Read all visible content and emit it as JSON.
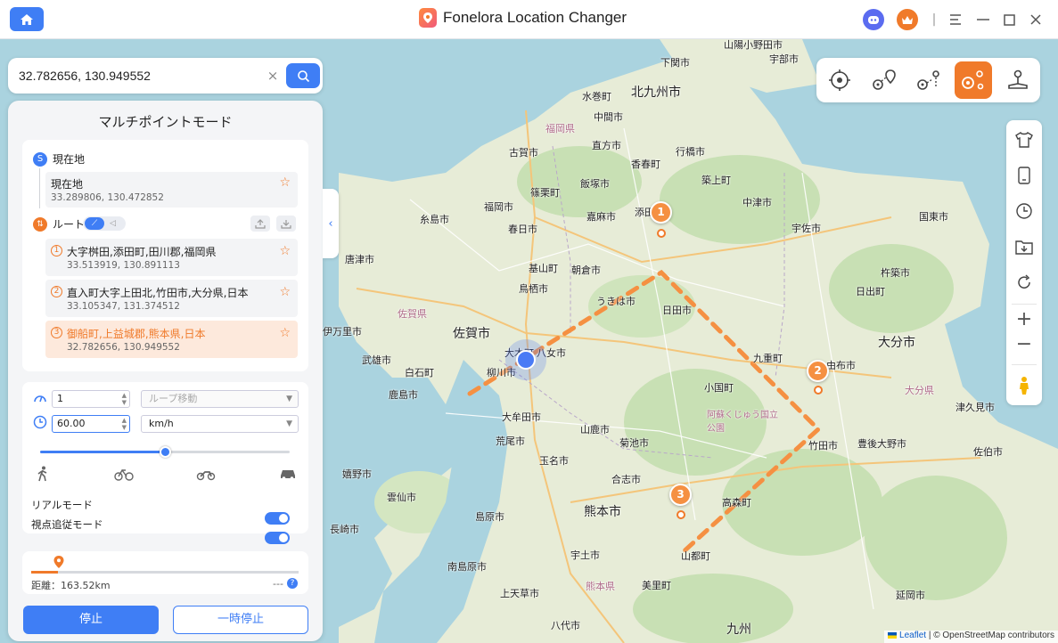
{
  "window": {
    "title": "Fonelora Location Changer"
  },
  "search": {
    "value": "32.782656, 130.949552",
    "clear_icon": "×"
  },
  "panel": {
    "title": "マルチポイントモード",
    "current": {
      "section_label": "現在地",
      "badge": "S",
      "item_name": "現在地",
      "item_coord": "33.289806, 130.472852"
    },
    "route": {
      "section_label": "ルート",
      "items": [
        {
          "num": "1",
          "name": "大字桝田,添田町,田川郡,福岡県",
          "coord": "33.513919, 130.891113"
        },
        {
          "num": "2",
          "name": "直入町大字上田北,竹田市,大分県,日本",
          "coord": "33.105347, 131.374512"
        },
        {
          "num": "3",
          "name": "御船町,上益城郡,熊本県,日本",
          "coord": "32.782656, 130.949552"
        }
      ]
    },
    "controls": {
      "loop_count": "1",
      "loop_mode": "ループ移動",
      "speed": "60.00",
      "speed_unit": "km/h",
      "speed_slider_fraction": 0.5,
      "real_mode_label": "リアルモード",
      "view_follow_label": "視点追従モード"
    },
    "progress": {
      "distance": "距離：163.52km",
      "time": "---",
      "help": "?",
      "progress_fraction": 0.1
    },
    "stop_label": "停止",
    "pause_label": "一時停止"
  },
  "attribution": {
    "leaflet": "Leaflet",
    "rest": "| © OpenStreetMap contributors"
  },
  "map_labels": [
    "山陽小野田市",
    "宇部市",
    "下関市",
    "北九州市",
    "水巻町",
    "中間市",
    "福岡県",
    "直方市",
    "古賀市",
    "香春町",
    "行橋市",
    "築上町",
    "篠栗町",
    "飯塚市",
    "添田",
    "中津市",
    "福岡市",
    "糸島市",
    "春日市",
    "嘉麻市",
    "宇佐市",
    "国東市",
    "基山町",
    "朝倉市",
    "唐津市",
    "鳥栖市",
    "杵築市",
    "日出町",
    "佐賀県",
    "うきは市",
    "日田市",
    "佐賀市",
    "大木町",
    "八女市",
    "九重町",
    "由布市",
    "大分市",
    "武雄市",
    "白石町",
    "柳川市",
    "小国町",
    "大分県",
    "伊万里市",
    "鹿島市",
    "大牟田市",
    "阿蘇くじゅう国立公園",
    "竹田市",
    "豊後大野市",
    "津久見市",
    "荒尾市",
    "山鹿市",
    "菊池市",
    "佐伯市",
    "嬉野市",
    "玉名市",
    "合志市",
    "高森町",
    "南島原市",
    "熊本市",
    "島原市",
    "宇土市",
    "山都町",
    "上天草市",
    "美里町",
    "延岡市",
    "八代市",
    "九州",
    "熊本県",
    "雲仙市",
    "長崎市"
  ],
  "colors": {
    "accent": "#3f7ef5",
    "route": "#f07a2a"
  }
}
